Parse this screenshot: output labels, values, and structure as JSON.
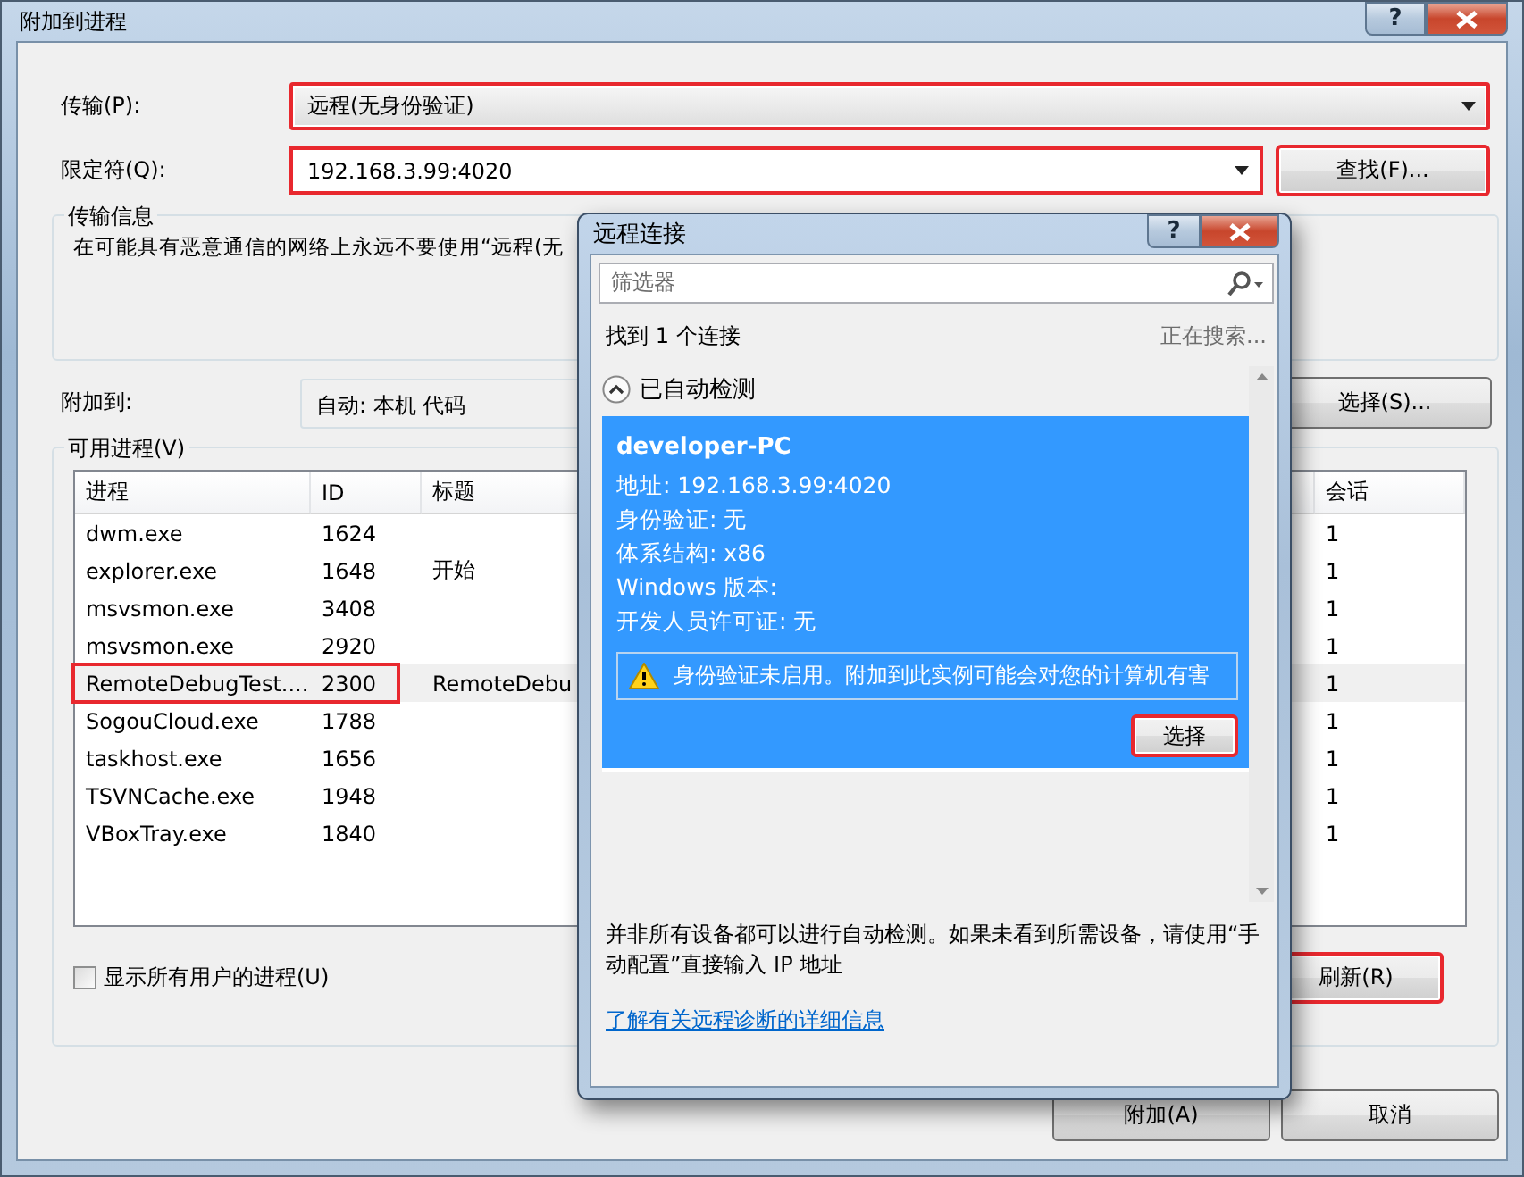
{
  "window": {
    "title": "附加到进程",
    "help": "?"
  },
  "transport": {
    "label": "传输(P):",
    "value": "远程(无身份验证)",
    "highlighted": true
  },
  "qualifier": {
    "label": "限定符(Q):",
    "value": "192.168.3.99:4020",
    "highlighted": true
  },
  "find_button": {
    "label": "查找(F)...",
    "highlighted": true
  },
  "transport_info": {
    "title": "传输信息",
    "text": "在可能具有恶意通信的网络上永远不要使用“远程(无"
  },
  "attach_to": {
    "label": "附加到:",
    "value": "自动: 本机 代码"
  },
  "select_button": {
    "label": "选择(S)..."
  },
  "processes": {
    "title": "可用进程(V)",
    "columns": [
      "进程",
      "ID",
      "标题",
      "会话"
    ],
    "rows": [
      {
        "process": "dwm.exe",
        "id": "1624",
        "session": "1",
        "selected": false,
        "highlighted": false
      },
      {
        "process": "explorer.exe",
        "id": "1648",
        "title": "开始",
        "session": "1",
        "selected": false,
        "highlighted": false
      },
      {
        "process": "msvsmon.exe",
        "id": "3408",
        "session": "1",
        "selected": false,
        "highlighted": false
      },
      {
        "process": "msvsmon.exe",
        "id": "2920",
        "session": "1",
        "selected": false,
        "highlighted": false
      },
      {
        "process": "RemoteDebugTest....",
        "id": "2300",
        "title": "RemoteDebu",
        "session": "1",
        "selected": true,
        "highlighted": true
      },
      {
        "process": "SogouCloud.exe",
        "id": "1788",
        "session": "1",
        "selected": false,
        "highlighted": false
      },
      {
        "process": "taskhost.exe",
        "id": "1656",
        "session": "1",
        "selected": false,
        "highlighted": false
      },
      {
        "process": "TSVNCache.exe",
        "id": "1948",
        "session": "1",
        "selected": false,
        "highlighted": false
      },
      {
        "process": "VBoxTray.exe",
        "id": "1840",
        "session": "1",
        "selected": false,
        "highlighted": false
      }
    ]
  },
  "show_all_users": {
    "label": "显示所有用户的进程(U)",
    "checked": false
  },
  "refresh_button": {
    "label": "刷新(R)",
    "highlighted": true
  },
  "attach_button": {
    "label": "附加(A)"
  },
  "cancel_button": {
    "label": "取消"
  },
  "remote_dialog": {
    "title": "远程连接",
    "help": "?",
    "filter": {
      "placeholder": "筛选器"
    },
    "found": "找到 1 个连接",
    "status": "正在搜索...",
    "group": {
      "label": "已自动检测",
      "expanded": true
    },
    "devices": [
      {
        "name": "developer-PC",
        "details": [
          "地址: 192.168.3.99:4020",
          "身份验证: 无",
          "体系结构: x86",
          "Windows 版本:",
          "开发人员许可证: 无"
        ],
        "warning": "身份验证未启用。附加到此实例可能会对您的计算机有害",
        "button": {
          "label": "选择",
          "highlighted": true
        },
        "selected": true
      }
    ],
    "note": "并非所有设备都可以进行自动检测。如果未看到所需设备，请使用“手动配置”直接输入 IP 地址",
    "link": "了解有关远程诊断的详细信息"
  }
}
